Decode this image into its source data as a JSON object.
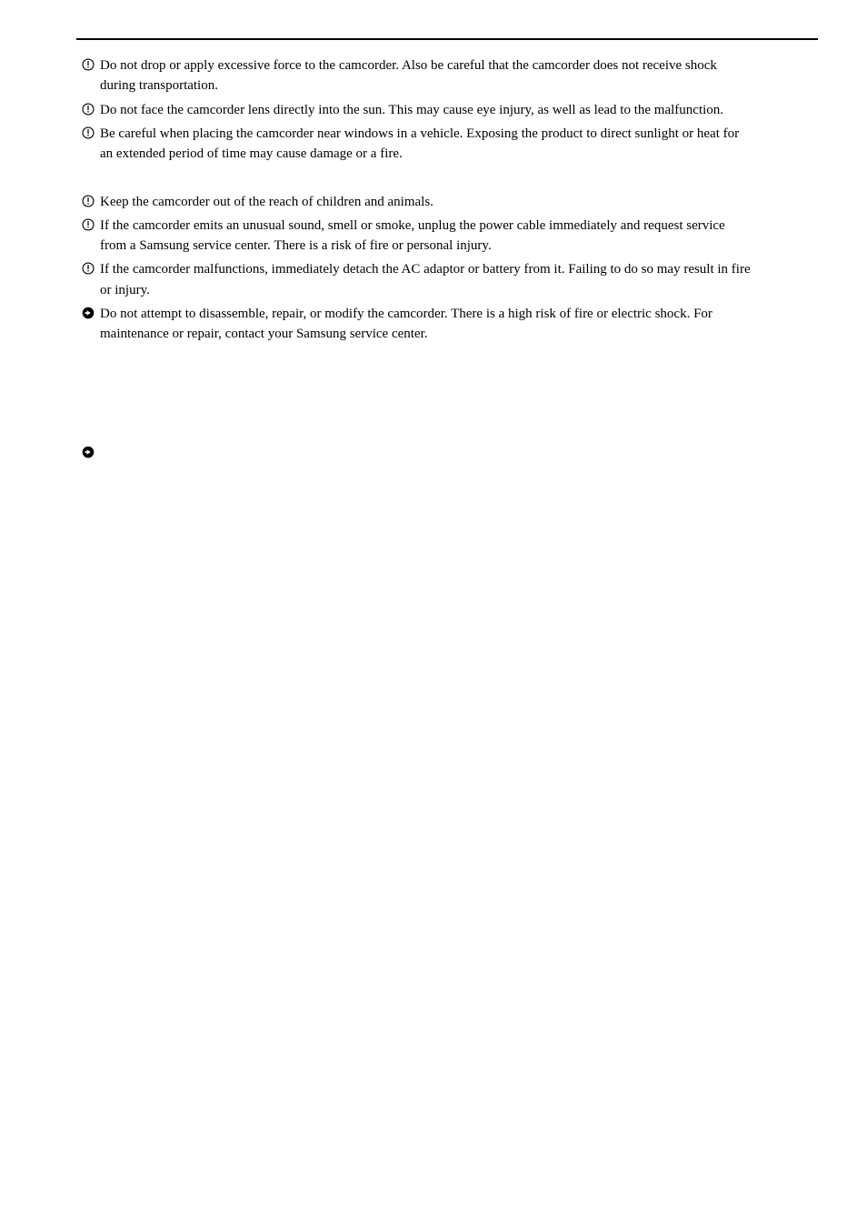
{
  "items": [
    {
      "icon": "warning",
      "lines": [
        "Do not drop or apply excessive force to the camcorder. Also be careful that the camcorder does not receive shock",
        "during transportation."
      ]
    },
    {
      "icon": "warning",
      "lines": [
        "Do not face the camcorder lens directly into the sun. This may cause eye injury, as well as lead to the malfunction."
      ]
    },
    {
      "icon": "warning",
      "lines": [
        "Be careful when placing the camcorder near windows in a vehicle. Exposing the product to direct sunlight or heat for",
        "an extended period of time may cause damage or a fire."
      ]
    },
    {
      "icon": "none",
      "lines": [
        ""
      ]
    },
    {
      "icon": "warning",
      "lines": [
        "Keep the camcorder out of the reach of children and animals."
      ]
    },
    {
      "icon": "warning",
      "lines": [
        "If the camcorder emits an unusual sound, smell or smoke, unplug the power cable immediately and request service",
        "from a Samsung service center. There is a risk of fire or personal injury."
      ]
    },
    {
      "icon": "warning",
      "lines": [
        "If the camcorder malfunctions, immediately detach the AC adaptor or battery from it. Failing to do so may result in fire",
        "or injury."
      ]
    },
    {
      "icon": "arrow",
      "lines": [
        "Do not attempt to disassemble, repair, or modify the camcorder. There is a high risk of fire or electric shock. For",
        "maintenance or repair, contact your Samsung service center."
      ]
    },
    {
      "icon": "none",
      "lines": [
        ""
      ]
    },
    {
      "icon": "none",
      "lines": [
        ""
      ]
    },
    {
      "icon": "none",
      "lines": [
        ""
      ]
    },
    {
      "icon": "none",
      "lines": [
        ""
      ]
    },
    {
      "icon": "arrow",
      "lines": [
        ""
      ]
    }
  ]
}
